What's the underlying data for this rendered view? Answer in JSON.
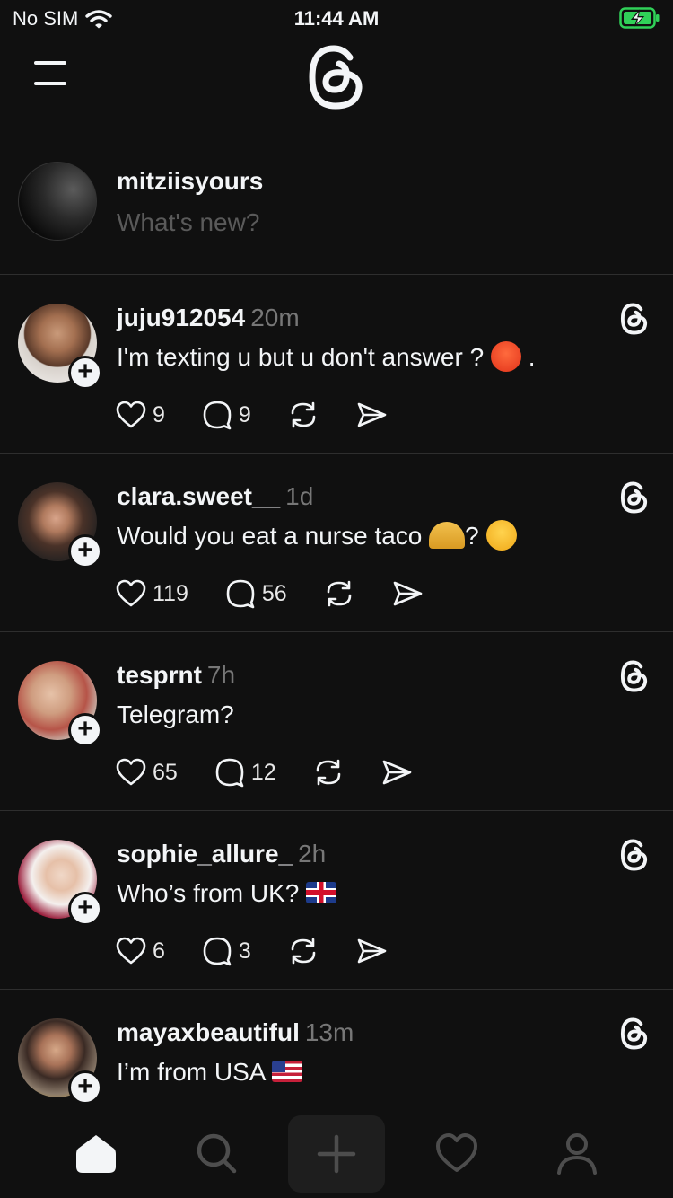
{
  "status_bar": {
    "carrier": "No SIM",
    "time": "11:44 AM",
    "battery_color": "#30d158"
  },
  "header": {
    "menu_icon": "menu-icon",
    "logo": "threads-logo"
  },
  "composer": {
    "username": "mitziisyours",
    "placeholder": "What's new?"
  },
  "posts": [
    {
      "username": "juju912054",
      "time": "20m",
      "text": "I'm texting u but u don't answer ?",
      "emoji": "angry-face",
      "suffix": " .",
      "likes": "9",
      "replies": "9"
    },
    {
      "username": "clara.sweet__",
      "time": "1d",
      "text": "Would you eat a nurse taco",
      "emoji": "taco",
      "suffix": "?",
      "emoji2": "face-peeking",
      "likes": "119",
      "replies": "56"
    },
    {
      "username": "tesprnt",
      "time": "7h",
      "text": "Telegram?",
      "likes": "65",
      "replies": "12"
    },
    {
      "username": "sophie_allure_",
      "time": "2h",
      "text": "Who’s from UK?",
      "emoji": "flag-uk",
      "likes": "6",
      "replies": "3"
    },
    {
      "username": "mayaxbeautiful",
      "time": "13m",
      "text": "I’m from USA",
      "emoji": "flag-us"
    }
  ],
  "tab_bar": {
    "items": [
      "home-icon",
      "search-icon",
      "new-thread-icon",
      "activity-icon",
      "profile-icon"
    ],
    "active": "home-icon"
  }
}
